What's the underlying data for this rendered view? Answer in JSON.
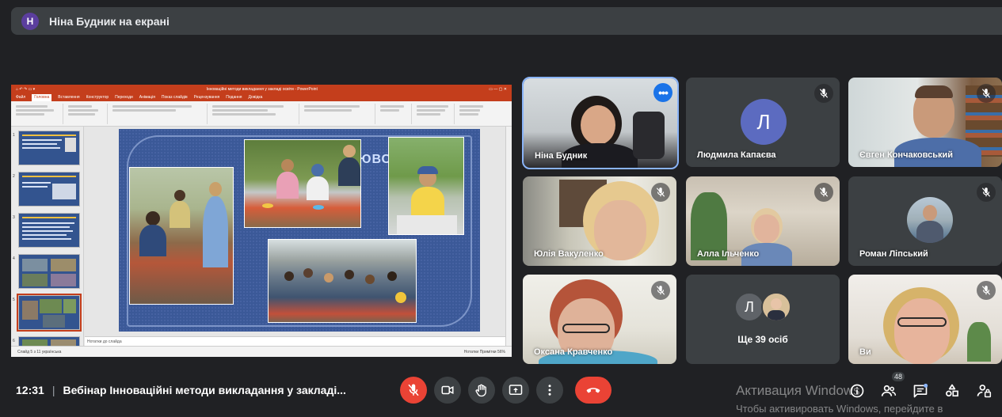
{
  "presenter_banner": {
    "avatar_letter": "Н",
    "text": "Ніна Будник на екрані"
  },
  "shared_screen": {
    "window_title": "Інноваційні методи викладання у закладі освіти - PowerPoint",
    "menu": [
      "Файл",
      "Головна",
      "Вставлення",
      "Конструктор",
      "Переходи",
      "Анімація",
      "Показ слайдів",
      "Рецензування",
      "Подання",
      "Довідка"
    ],
    "slide_word": "ЮВС",
    "notes_placeholder": "Нотатки до слайда",
    "status_left": "Слайд 5 з 11   українська",
    "status_right": "Нотатки   Примітки   56%",
    "slide_numbers": [
      "1",
      "2",
      "3",
      "4",
      "5",
      "6"
    ]
  },
  "participants": [
    {
      "name": "Ніна Будник",
      "muted": false,
      "has_more": true
    },
    {
      "name": "Людмила Капаєва",
      "muted": true,
      "avatar_letter": "Л"
    },
    {
      "name": "Євген Кончаковський",
      "muted": true
    },
    {
      "name": "Юлія Вакуленко",
      "muted": true
    },
    {
      "name": "Алла Ільченко",
      "muted": true
    },
    {
      "name": "Роман Ліпський",
      "muted": true
    },
    {
      "name": "Оксана Кравченко",
      "muted": true
    },
    {
      "name": "Ще 39 осіб",
      "avatar_letter": "Л"
    },
    {
      "name": "Ви",
      "muted": true
    }
  ],
  "bottom_bar": {
    "time": "12:31",
    "separator": "|",
    "meeting_title": "Вебінар Інноваційні методи викладання у закладі...",
    "participants_count": "48"
  },
  "watermark": {
    "line1": "Активация Windows",
    "line2": "Чтобы активировать Windows, перейдите в"
  },
  "colors": {
    "background": "#202124",
    "tile": "#3c4043",
    "end_call": "#ea4335",
    "focus": "#8ab4f8",
    "powerpoint": "#c43e1c"
  }
}
